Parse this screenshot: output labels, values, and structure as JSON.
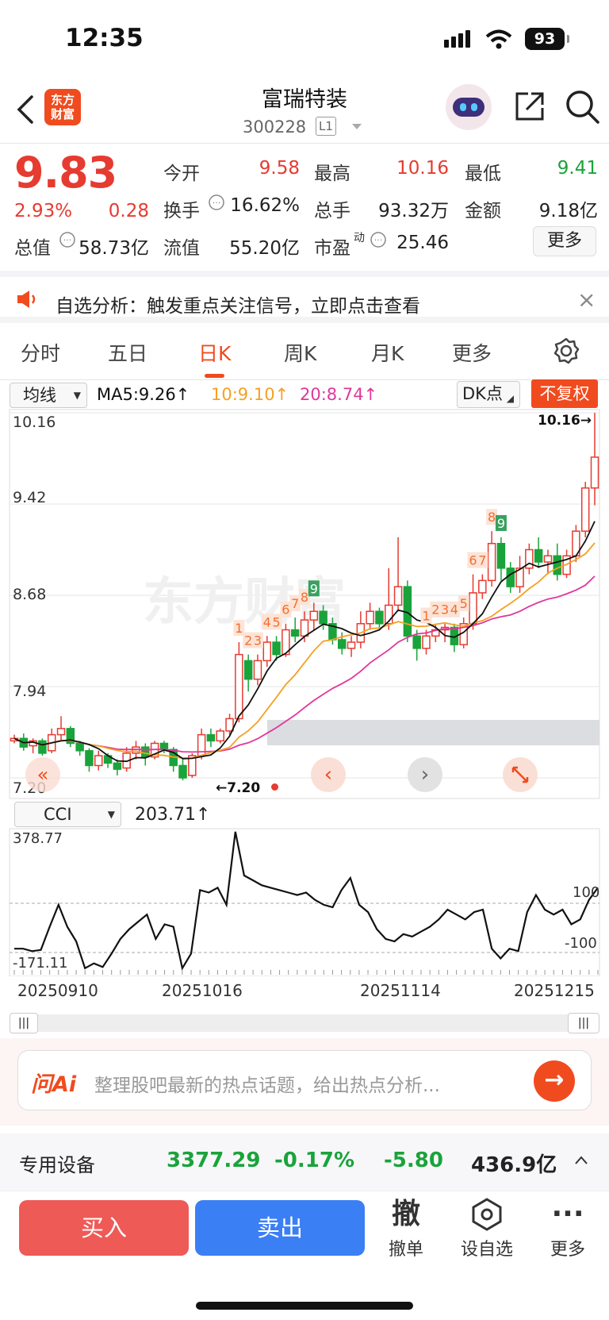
{
  "status": {
    "time": "12:35",
    "battery": "93"
  },
  "header": {
    "logo_line1": "东方",
    "logo_line2": "财富",
    "title": "富瑞特装",
    "code": "300228",
    "badge": "L1"
  },
  "quote": {
    "price": "9.83",
    "pct": "2.93%",
    "chg": "0.28",
    "open_label": "今开",
    "open": "9.58",
    "high_label": "最高",
    "high": "10.16",
    "low_label": "最低",
    "low": "9.41",
    "turnover_label": "换手",
    "turnover": "16.62%",
    "vol_label": "总手",
    "vol": "93.32万",
    "amount_label": "金额",
    "amount": "9.18亿",
    "mcap_label": "总值",
    "mcap": "58.73亿",
    "float_label": "流值",
    "float": "55.20亿",
    "pe_label": "市盈",
    "pe_sup": "动",
    "pe": "25.46",
    "more": "更多"
  },
  "banner": {
    "text": "自选分析：触发重点关注信号，立即点击查看",
    "close": "×"
  },
  "tabs": [
    {
      "label": "分时"
    },
    {
      "label": "五日"
    },
    {
      "label": "日K"
    },
    {
      "label": "周K"
    },
    {
      "label": "月K"
    },
    {
      "label": "更多"
    }
  ],
  "kline": {
    "indicator": "均线",
    "ma5": "MA5:9.26↑",
    "ma10": "10:9.10↑",
    "ma20": "20:8.74↑",
    "dk": "DK点",
    "fq": "不复权",
    "max_label": "10.16→",
    "min_label": "←7.20",
    "y_ticks": [
      "10.16",
      "9.42",
      "8.68",
      "7.94",
      "7.20"
    ],
    "colors": {
      "up": "#e63b30",
      "down": "#1aa33b",
      "ma5": "#111111",
      "ma10": "#f5a023",
      "ma20": "#e0379c"
    }
  },
  "cci": {
    "name": "CCI",
    "value": "203.71↑",
    "top": "378.77",
    "bottom": "-171.11",
    "l100": "100",
    "lm100": "-100",
    "dates": [
      "20250910",
      "20251016",
      "20251114",
      "20251215"
    ]
  },
  "ask": {
    "brand": "问Ai",
    "placeholder": "整理股吧最新的热点话题，给出热点分析..."
  },
  "sector": {
    "name": "专用设备",
    "index": "3377.29",
    "pct": "-0.17%",
    "chg": "-5.80",
    "amount": "436.9亿"
  },
  "bottom": {
    "buy": "买入",
    "sell": "卖出",
    "cancel_icon": "撤",
    "cancel": "撤单",
    "fav": "设自选",
    "more": "更多"
  },
  "chart_data": {
    "type": "candlestick",
    "y_ticks": [
      10.16,
      9.42,
      8.68,
      7.94,
      7.2
    ],
    "high": 10.16,
    "low": 7.2,
    "ma": {
      "MA5": 9.26,
      "MA10": 9.1,
      "MA20": 8.74
    },
    "candles": [
      [
        7.5,
        7.52,
        7.48,
        7.55
      ],
      [
        7.52,
        7.45,
        7.42,
        7.56
      ],
      [
        7.46,
        7.5,
        7.4,
        7.52
      ],
      [
        7.5,
        7.4,
        7.38,
        7.52
      ],
      [
        7.42,
        7.55,
        7.4,
        7.6
      ],
      [
        7.55,
        7.6,
        7.5,
        7.7
      ],
      [
        7.6,
        7.48,
        7.45,
        7.62
      ],
      [
        7.48,
        7.42,
        7.38,
        7.5
      ],
      [
        7.42,
        7.3,
        7.25,
        7.44
      ],
      [
        7.3,
        7.38,
        7.26,
        7.42
      ],
      [
        7.38,
        7.32,
        7.28,
        7.4
      ],
      [
        7.32,
        7.27,
        7.22,
        7.35
      ],
      [
        7.28,
        7.4,
        7.25,
        7.45
      ],
      [
        7.4,
        7.45,
        7.35,
        7.5
      ],
      [
        7.45,
        7.37,
        7.3,
        7.48
      ],
      [
        7.37,
        7.48,
        7.35,
        7.5
      ],
      [
        7.48,
        7.43,
        7.4,
        7.5
      ],
      [
        7.43,
        7.3,
        7.25,
        7.45
      ],
      [
        7.3,
        7.2,
        7.18,
        7.35
      ],
      [
        7.22,
        7.38,
        7.2,
        7.4
      ],
      [
        7.38,
        7.55,
        7.35,
        7.6
      ],
      [
        7.55,
        7.5,
        7.45,
        7.6
      ],
      [
        7.5,
        7.58,
        7.48,
        7.6
      ],
      [
        7.58,
        7.68,
        7.55,
        7.72
      ],
      [
        7.68,
        8.2,
        7.65,
        8.3
      ],
      [
        8.15,
        8.0,
        7.9,
        8.2
      ],
      [
        8.0,
        8.15,
        7.95,
        8.2
      ],
      [
        8.15,
        8.3,
        8.1,
        8.35
      ],
      [
        8.3,
        8.2,
        8.15,
        8.35
      ],
      [
        8.2,
        8.4,
        8.18,
        8.45
      ],
      [
        8.4,
        8.35,
        8.3,
        8.5
      ],
      [
        8.35,
        8.48,
        8.3,
        8.55
      ],
      [
        8.48,
        8.55,
        8.4,
        8.62
      ],
      [
        8.55,
        8.45,
        8.4,
        8.6
      ],
      [
        8.45,
        8.32,
        8.28,
        8.5
      ],
      [
        8.32,
        8.25,
        8.2,
        8.38
      ],
      [
        8.25,
        8.3,
        8.18,
        8.35
      ],
      [
        8.3,
        8.45,
        8.25,
        8.55
      ],
      [
        8.45,
        8.55,
        8.4,
        8.62
      ],
      [
        8.55,
        8.45,
        8.4,
        8.58
      ],
      [
        8.45,
        8.6,
        8.4,
        8.9
      ],
      [
        8.6,
        8.75,
        8.55,
        9.15
      ],
      [
        8.75,
        8.35,
        8.3,
        8.8
      ],
      [
        8.35,
        8.25,
        8.15,
        8.4
      ],
      [
        8.25,
        8.35,
        8.2,
        8.4
      ],
      [
        8.35,
        8.4,
        8.3,
        8.45
      ],
      [
        8.4,
        8.42,
        8.3,
        8.45
      ],
      [
        8.42,
        8.28,
        8.22,
        8.45
      ],
      [
        8.28,
        8.45,
        8.25,
        8.5
      ],
      [
        8.45,
        8.7,
        8.4,
        8.85
      ],
      [
        8.7,
        8.8,
        8.65,
        8.85
      ],
      [
        8.8,
        9.1,
        8.75,
        9.2
      ],
      [
        9.1,
        8.9,
        8.8,
        9.15
      ],
      [
        8.9,
        8.75,
        8.7,
        8.95
      ],
      [
        8.75,
        8.9,
        8.7,
        9.0
      ],
      [
        8.9,
        9.05,
        8.85,
        9.1
      ],
      [
        9.05,
        8.95,
        8.9,
        9.15
      ],
      [
        8.95,
        9.0,
        8.85,
        9.05
      ],
      [
        9.0,
        8.85,
        8.8,
        9.1
      ],
      [
        8.85,
        9.0,
        8.82,
        9.05
      ],
      [
        9.0,
        9.2,
        8.95,
        9.25
      ],
      [
        9.2,
        9.55,
        9.15,
        9.6
      ],
      [
        9.55,
        9.8,
        9.41,
        10.16
      ]
    ]
  }
}
